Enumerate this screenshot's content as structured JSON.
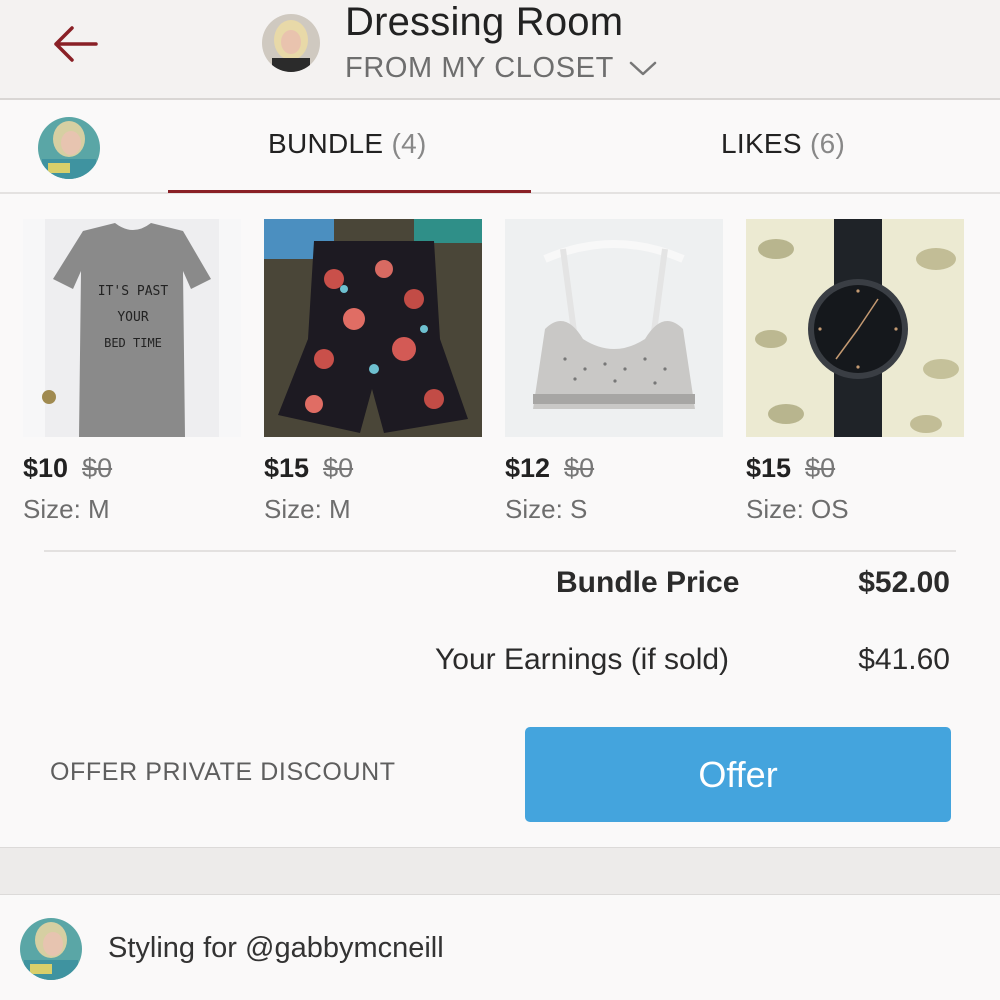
{
  "header": {
    "title": "Dressing Room",
    "subtitle": "FROM MY CLOSET"
  },
  "tabs": [
    {
      "label": "BUNDLE",
      "count": "(4)",
      "active": true
    },
    {
      "label": "LIKES",
      "count": "(6)",
      "active": false
    }
  ],
  "items": [
    {
      "price": "$10",
      "original_price": "$0",
      "size": "Size: M",
      "thumb_text": [
        "IT'S PAST",
        "YOUR",
        "BED TIME"
      ]
    },
    {
      "price": "$15",
      "original_price": "$0",
      "size": "Size: M"
    },
    {
      "price": "$12",
      "original_price": "$0",
      "size": "Size: S"
    },
    {
      "price": "$15",
      "original_price": "$0",
      "size": "Size: OS"
    }
  ],
  "totals": {
    "bundle_label": "Bundle Price",
    "bundle_value": "$52.00",
    "earnings_label": "Your Earnings (if sold)",
    "earnings_value": "$41.60"
  },
  "actions": {
    "discount_label": "OFFER PRIVATE DISCOUNT",
    "offer_label": "Offer"
  },
  "styling": {
    "text": "Styling for @gabbymcneill"
  },
  "colors": {
    "accent_red": "#8a2026",
    "offer_blue": "#44a4dd"
  }
}
